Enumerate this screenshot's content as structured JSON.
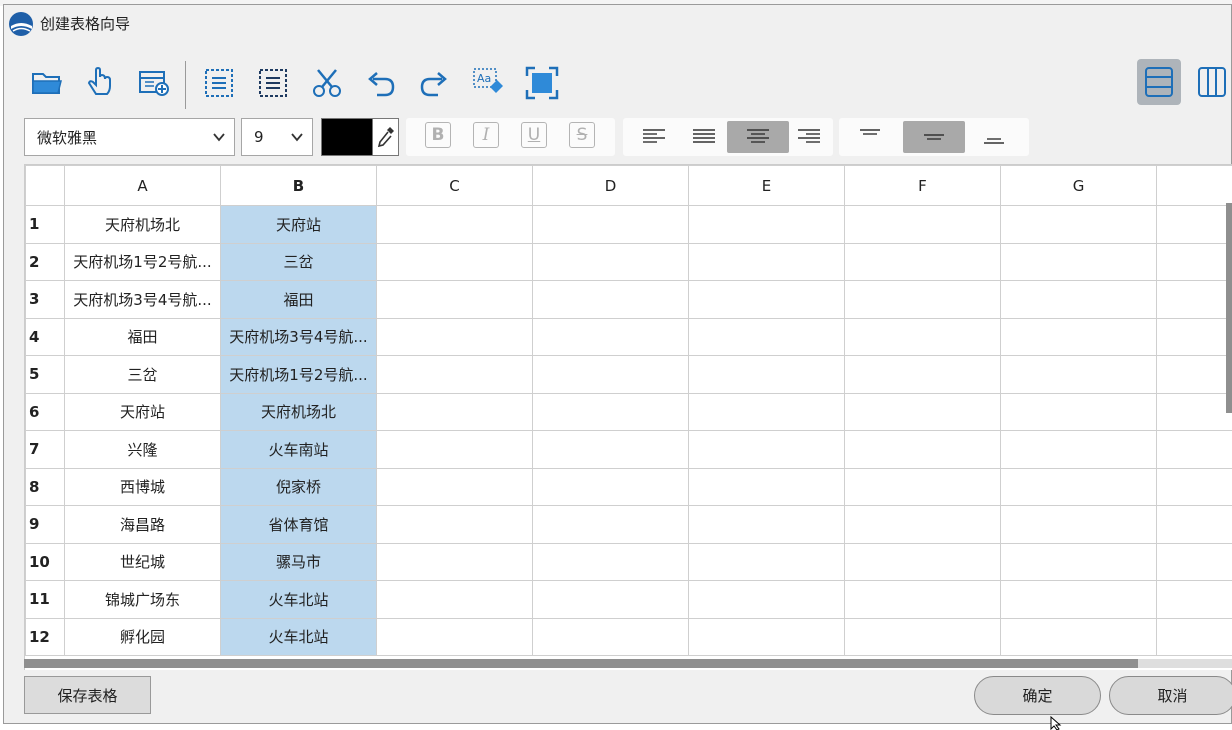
{
  "window": {
    "title": "创建表格向导"
  },
  "toolbar": {
    "icons": [
      "folder-open-icon",
      "hand-pointer-icon",
      "insert-table-icon",
      "copy-doc-icon",
      "paste-doc-icon",
      "scissors-icon",
      "undo-icon",
      "redo-icon",
      "font-format-icon",
      "fit-frame-icon"
    ],
    "view_modes": [
      "rows-view-icon",
      "columns-view-icon"
    ],
    "active_view": "rows"
  },
  "format": {
    "font_family": "微软雅黑",
    "font_size": "9",
    "color": "#000000",
    "style_buttons": [
      "B",
      "I",
      "U",
      "S"
    ],
    "h_align_active": "center",
    "v_align_active": "middle"
  },
  "grid": {
    "columns": [
      "A",
      "B",
      "C",
      "D",
      "E",
      "F",
      "G"
    ],
    "selected_column": "B",
    "rows": [
      {
        "num": "1",
        "a": "天府机场北",
        "b": "天府站"
      },
      {
        "num": "2",
        "a": "天府机场1号2号航...",
        "b": "三岔"
      },
      {
        "num": "3",
        "a": "天府机场3号4号航...",
        "b": "福田"
      },
      {
        "num": "4",
        "a": "福田",
        "b": "天府机场3号4号航..."
      },
      {
        "num": "5",
        "a": "三岔",
        "b": "天府机场1号2号航..."
      },
      {
        "num": "6",
        "a": "天府站",
        "b": "天府机场北"
      },
      {
        "num": "7",
        "a": "兴隆",
        "b": "火车南站"
      },
      {
        "num": "8",
        "a": "西博城",
        "b": "倪家桥"
      },
      {
        "num": "9",
        "a": "海昌路",
        "b": "省体育馆"
      },
      {
        "num": "10",
        "a": "世纪城",
        "b": "骡马市"
      },
      {
        "num": "11",
        "a": "锦城广场东",
        "b": "火车北站"
      },
      {
        "num": "12",
        "a": "孵化园",
        "b": "火车北站"
      }
    ]
  },
  "footer": {
    "save_label": "保存表格",
    "ok_label": "确定",
    "cancel_label": "取消"
  }
}
